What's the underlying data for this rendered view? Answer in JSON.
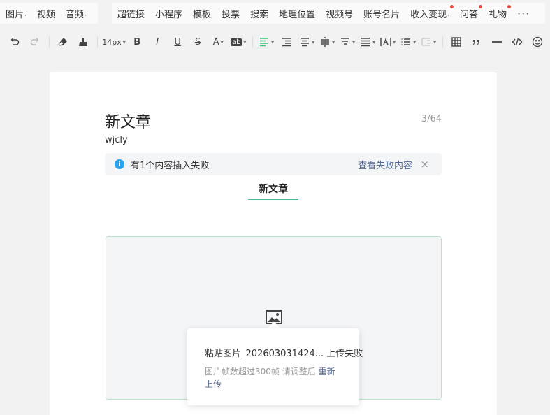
{
  "insert_menu": {
    "group1": [
      {
        "label": "图片",
        "caret": true
      },
      {
        "label": "视频",
        "caret": false
      },
      {
        "label": "音频",
        "caret": true
      }
    ],
    "group2": [
      {
        "label": "超链接",
        "caret": false,
        "dot": false
      },
      {
        "label": "小程序",
        "caret": false,
        "dot": false
      },
      {
        "label": "模板",
        "caret": false,
        "dot": false
      },
      {
        "label": "投票",
        "caret": false,
        "dot": false
      },
      {
        "label": "搜索",
        "caret": false,
        "dot": false
      },
      {
        "label": "地理位置",
        "caret": false,
        "dot": false
      },
      {
        "label": "视频号",
        "caret": false,
        "dot": false
      },
      {
        "label": "账号名片",
        "caret": false,
        "dot": false
      },
      {
        "label": "收入变现",
        "caret": true,
        "dot": true
      },
      {
        "label": "问答",
        "caret": false,
        "dot": true
      },
      {
        "label": "礼物",
        "caret": false,
        "dot": true
      }
    ],
    "more": "···"
  },
  "toolbar": {
    "font_size": "14px",
    "bold": "B",
    "italic": "I",
    "underline": "U",
    "strike": "S",
    "font_color": "A",
    "bg_color": "ab",
    "caret": "▾"
  },
  "editor": {
    "title": "新文章",
    "title_counter": "3/64",
    "author": "wjcly",
    "notice": {
      "icon_text": "i",
      "text": "有1个内容插入失败",
      "link": "查看失败内容",
      "close": "×"
    },
    "heading": "新文章",
    "popup": {
      "title": "粘贴图片_202603031424... 上传失败",
      "desc": "图片帧数超过300帧 请调整后 ",
      "retry": "重新上传"
    }
  },
  "colors": {
    "accent_green": "#3dbf7a",
    "link_blue": "#576b95",
    "info_blue": "#2aa3ee",
    "red_dot": "#f04a3c"
  }
}
